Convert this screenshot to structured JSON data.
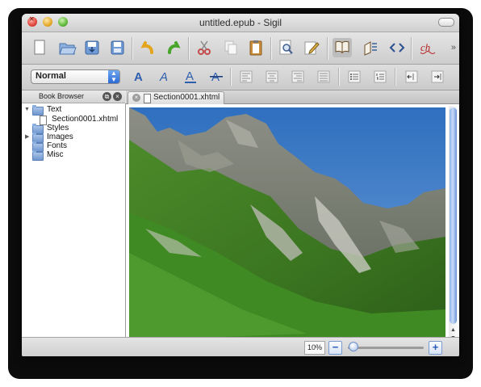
{
  "window": {
    "title": "untitled.epub - Sigil"
  },
  "toolbar": {
    "buttons": [
      {
        "name": "new-file",
        "icon": "new-document-icon"
      },
      {
        "name": "open",
        "icon": "open-folder-icon"
      },
      {
        "name": "save",
        "icon": "save-icon"
      },
      {
        "name": "save-as",
        "icon": "save-as-icon"
      },
      {
        "name": "undo",
        "icon": "undo-icon"
      },
      {
        "name": "redo",
        "icon": "redo-icon"
      },
      {
        "name": "cut",
        "icon": "scissors-icon"
      },
      {
        "name": "copy",
        "icon": "copy-icon"
      },
      {
        "name": "paste",
        "icon": "clipboard-icon"
      },
      {
        "name": "find-replace",
        "icon": "magnifier-icon"
      },
      {
        "name": "meta-editor",
        "icon": "pencil-edit-icon"
      },
      {
        "name": "book-view",
        "icon": "book-icon"
      },
      {
        "name": "split-view",
        "icon": "split-view-icon"
      },
      {
        "name": "code-view",
        "icon": "code-brackets-icon"
      },
      {
        "name": "spellcheck",
        "icon": "spellcheck-icon"
      }
    ],
    "overflow": "»"
  },
  "format_toolbar": {
    "heading_select": "Normal",
    "buttons": [
      "bold-icon",
      "italic-icon",
      "underline-icon",
      "strikethrough-icon",
      "align-left-icon",
      "align-center-icon",
      "align-right-icon",
      "align-justify-icon",
      "bullet-list-icon",
      "numbered-list-icon",
      "decrease-indent-icon",
      "increase-indent-icon"
    ]
  },
  "book_browser": {
    "title": "Book Browser",
    "tree": [
      {
        "label": "Text",
        "expanded": true,
        "children": [
          {
            "label": "Section0001.xhtml"
          }
        ]
      },
      {
        "label": "Styles"
      },
      {
        "label": "Images",
        "collapsed_arrow": true
      },
      {
        "label": "Fonts"
      },
      {
        "label": "Misc"
      }
    ]
  },
  "tabs": [
    {
      "label": "Section0001.xhtml",
      "active": true
    }
  ],
  "statusbar": {
    "zoom": "10%",
    "zoom_out": "−",
    "zoom_in": "+",
    "zoom_fraction": 0.05
  },
  "colors": {
    "accent": "#2c6ad6",
    "sky": "#3f79c4",
    "grass": "#3f7a22"
  }
}
